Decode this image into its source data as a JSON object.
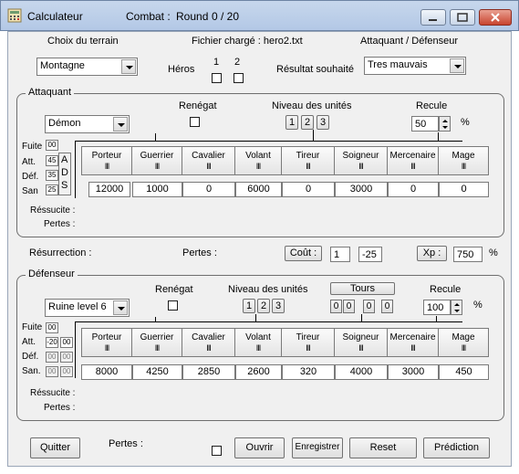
{
  "window": {
    "title": "Calculateur",
    "combat_label": "Combat :",
    "round_label": "Round",
    "round_value": "0 / 20"
  },
  "top": {
    "terrain_label": "Choix du terrain",
    "terrain_value": "Montagne",
    "file_label": "Fichier chargé : hero2.txt",
    "heros_label": "Héros",
    "hero1": "1",
    "hero2": "2",
    "ad_label": "Attaquant / Défenseur",
    "result_label": "Résultat souhaité",
    "result_value": "Tres mauvais"
  },
  "attaquant": {
    "group_label": "Attaquant",
    "unit_type": "Démon",
    "renegat_label": "Renégat",
    "niveau_label": "Niveau des unités",
    "niveaux": [
      "1",
      "2",
      "3"
    ],
    "recule_label": "Recule",
    "recule_value": "50",
    "percent": "%",
    "stats": [
      {
        "label": "Fuite",
        "value": "00"
      },
      {
        "label": "Att.",
        "value": "45"
      },
      {
        "label": "Déf.",
        "value": "35"
      },
      {
        "label": "San",
        "value": "25"
      }
    ],
    "ads": [
      "A",
      "D",
      "S"
    ],
    "units": [
      {
        "name": "Porteur",
        "bars": "III",
        "value": "12000"
      },
      {
        "name": "Guerrier",
        "bars": "III",
        "value": "1000"
      },
      {
        "name": "Cavalier",
        "bars": "III",
        "value": "0"
      },
      {
        "name": "Volant",
        "bars": "III",
        "value": "6000"
      },
      {
        "name": "Tireur",
        "bars": "III",
        "value": "0"
      },
      {
        "name": "Soigneur",
        "bars": "III",
        "value": "3000"
      },
      {
        "name": "Mercenaire",
        "bars": "III",
        "value": "0"
      },
      {
        "name": "Mage",
        "bars": "III",
        "value": "0"
      }
    ],
    "ressucite_label": "Réssucite :",
    "pertes_label": "Pertes :"
  },
  "middle": {
    "resurrection_label": "Résurrection :",
    "pertes_label": "Pertes :",
    "cout_label": "Coût :",
    "cout_value1": "1",
    "cout_value2": "-25",
    "xp_label": "Xp :",
    "xp_value": "750",
    "percent": "%"
  },
  "defenseur": {
    "group_label": "Défenseur",
    "unit_type": "Ruine level 6",
    "renegat_label": "Renégat",
    "niveau_label": "Niveau des unités",
    "niveaux": [
      "1",
      "2",
      "3"
    ],
    "tours_label": "Tours",
    "tours": [
      "0",
      "0",
      "0",
      "0"
    ],
    "recule_label": "Recule",
    "recule_value": "100",
    "percent": "%",
    "stats": [
      {
        "label": "Fuite",
        "value": "00"
      },
      {
        "label": "Att.",
        "value": "-20"
      },
      {
        "label": "Déf.",
        "value": "00"
      },
      {
        "label": "San.",
        "value": "00"
      }
    ],
    "stats2": [
      "00",
      "00",
      "00"
    ],
    "units": [
      {
        "name": "Porteur",
        "bars": "III",
        "value": "8000"
      },
      {
        "name": "Guerrier",
        "bars": "III",
        "value": "4250"
      },
      {
        "name": "Cavalier",
        "bars": "III",
        "value": "2850"
      },
      {
        "name": "Volant",
        "bars": "III",
        "value": "2600"
      },
      {
        "name": "Tireur",
        "bars": "III",
        "value": "320"
      },
      {
        "name": "Soigneur",
        "bars": "III",
        "value": "4000"
      },
      {
        "name": "Mercenaire",
        "bars": "III",
        "value": "3000"
      },
      {
        "name": "Mage",
        "bars": "III",
        "value": "450"
      }
    ],
    "ressucite_label": "Réssucite :",
    "pertes_label": "Pertes :"
  },
  "bottom": {
    "quit": "Quitter",
    "pertes_label": "Pertes :",
    "open": "Ouvrir",
    "save": "Enregistrer",
    "reset": "Reset",
    "predict": "Prédiction"
  }
}
